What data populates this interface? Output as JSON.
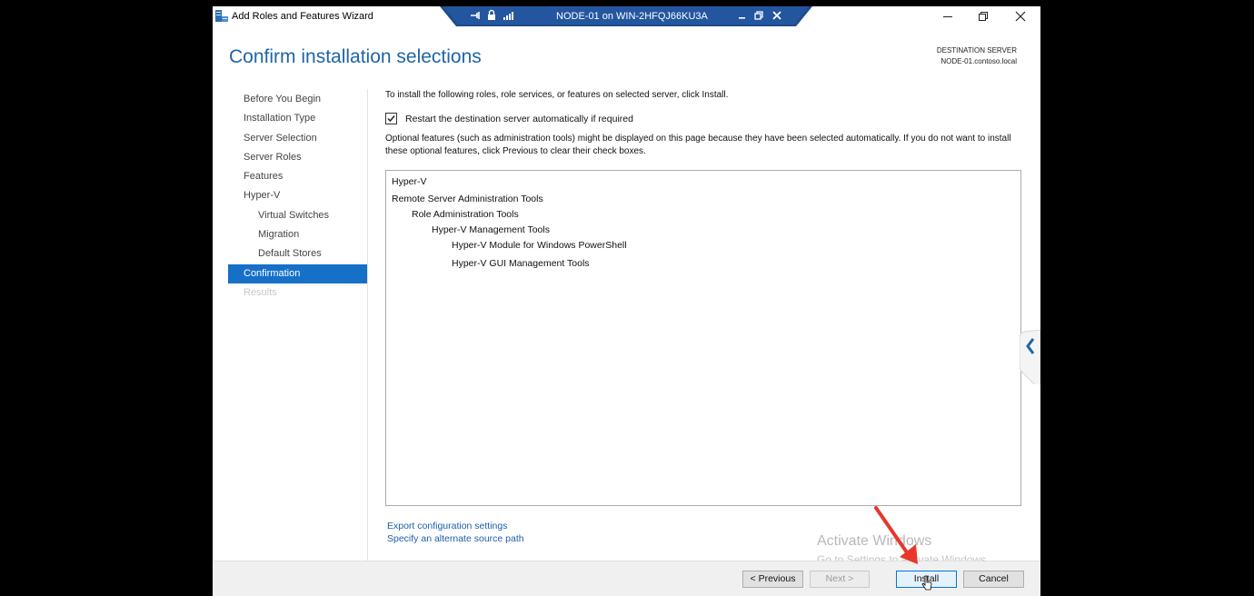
{
  "window": {
    "title": "Add Roles and Features Wizard"
  },
  "rdp": {
    "title": "NODE-01 on WIN-2HFQJ66KU3A"
  },
  "header": {
    "page_title": "Confirm installation selections",
    "destination_label": "DESTINATION SERVER",
    "destination_name": "NODE-01.contoso.local"
  },
  "nav": {
    "items": [
      {
        "label": "Before You Begin",
        "level": 0,
        "state": "normal"
      },
      {
        "label": "Installation Type",
        "level": 0,
        "state": "normal"
      },
      {
        "label": "Server Selection",
        "level": 0,
        "state": "normal"
      },
      {
        "label": "Server Roles",
        "level": 0,
        "state": "normal"
      },
      {
        "label": "Features",
        "level": 0,
        "state": "normal"
      },
      {
        "label": "Hyper-V",
        "level": 0,
        "state": "normal"
      },
      {
        "label": "Virtual Switches",
        "level": 1,
        "state": "normal"
      },
      {
        "label": "Migration",
        "level": 1,
        "state": "normal"
      },
      {
        "label": "Default Stores",
        "level": 1,
        "state": "normal"
      },
      {
        "label": "Confirmation",
        "level": 0,
        "state": "active"
      },
      {
        "label": "Results",
        "level": 0,
        "state": "disabled"
      }
    ]
  },
  "content": {
    "intro": "To install the following roles, role services, or features on selected server, click Install.",
    "restart_checkbox": {
      "label": "Restart the destination server automatically if required",
      "checked": true
    },
    "optional_note": "Optional features (such as administration tools) might be displayed on this page because they have been selected automatically. If you do not want to install these optional features, click Previous to clear their check boxes.",
    "selections": [
      {
        "label": "Hyper-V",
        "level": 0
      },
      {
        "label": "Remote Server Administration Tools",
        "level": 0
      },
      {
        "label": "Role Administration Tools",
        "level": 1
      },
      {
        "label": "Hyper-V Management Tools",
        "level": 2
      },
      {
        "label": "Hyper-V Module for Windows PowerShell",
        "level": 3
      },
      {
        "label": "Hyper-V GUI Management Tools",
        "level": 3
      }
    ],
    "export_link": "Export configuration settings",
    "alt_source_link": "Specify an alternate source path"
  },
  "watermark": {
    "line1": "Activate Windows",
    "line2": "Go to Settings to activate Windows."
  },
  "footer": {
    "previous": "< Previous",
    "next": "Next >",
    "install": "Install",
    "cancel": "Cancel"
  },
  "colors": {
    "accent": "#1670c8",
    "title_blue": "#1e64a8",
    "rdp_bar": "#1f4c8a",
    "annotation_arrow": "#e8362b"
  }
}
